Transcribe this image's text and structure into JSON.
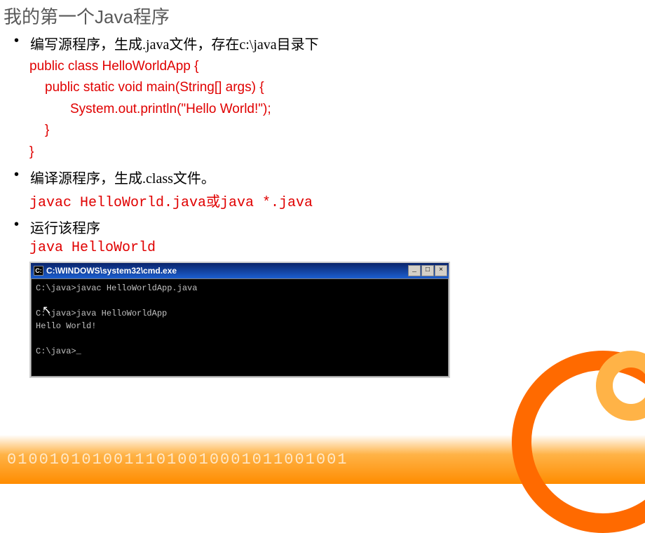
{
  "title": "我的第一个Java程序",
  "bullet1": "编写源程序，生成.java文件，存在c:\\java目录下",
  "code": {
    "l1": "public class HelloWorldApp {",
    "l2": "public static void main(String[] args) {",
    "l3": "System.out.println(\"Hello World!\");",
    "l4": "}",
    "l5": "}"
  },
  "bullet2": "编译源程序，生成.class文件。",
  "compile": "javac HelloWorld.java或java *.java",
  "bullet3": "运行该程序",
  "run": "java HelloWorld",
  "terminal": {
    "title": "C:\\WINDOWS\\system32\\cmd.exe",
    "body": "C:\\java>javac HelloWorldApp.java\n\nC:\\java>java HelloWorldApp\nHello World!\n\nC:\\java>_"
  },
  "binary": "01001010100111010010001011001001"
}
